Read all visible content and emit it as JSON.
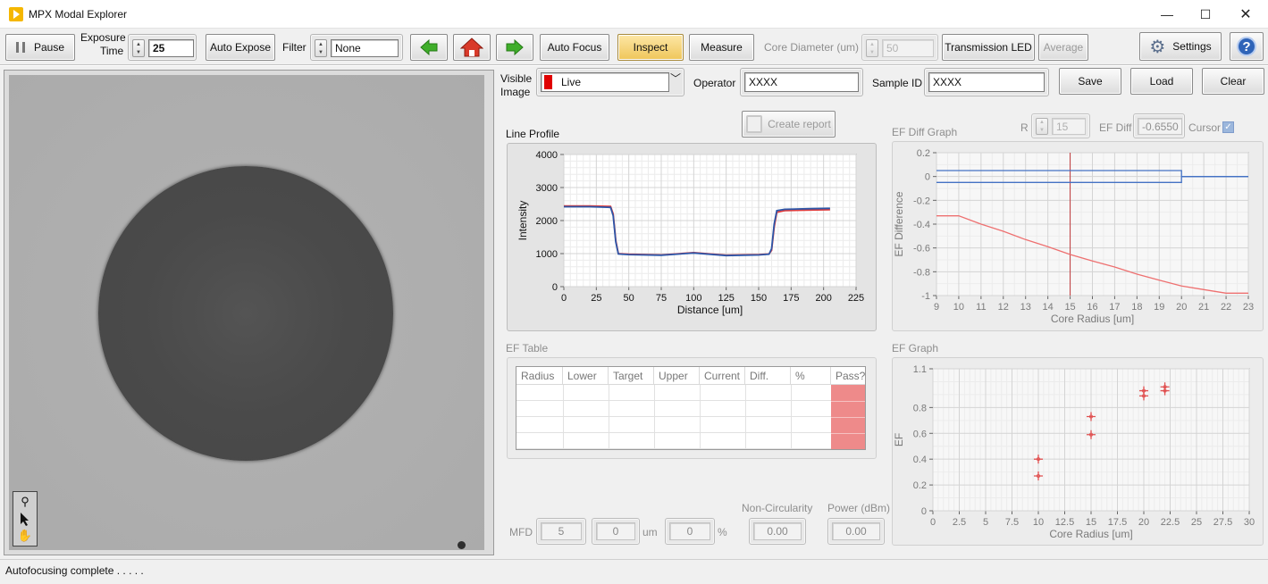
{
  "window": {
    "title": "MPX Modal Explorer"
  },
  "toolbar": {
    "pause": "Pause",
    "exposure_label_1": "Exposure",
    "exposure_label_2": "Time",
    "exposure_value": "25",
    "auto_expose": "Auto Expose",
    "filter_label": "Filter",
    "filter_value": "None",
    "auto_focus": "Auto Focus",
    "inspect": "Inspect",
    "measure": "Measure",
    "core_diameter_label": "Core Diameter (um)",
    "core_diameter_value": "50",
    "transmission_led": "Transmission LED",
    "average": "Average",
    "settings": "Settings"
  },
  "controls": {
    "visible_image_1": "Visible",
    "visible_image_2": "Image",
    "visible_image_value": "Live",
    "visible_image_color": "#e00000",
    "operator_label": "Operator",
    "operator_value": "XXXX",
    "sample_id_label": "Sample ID",
    "sample_id_value": "XXXX",
    "save": "Save",
    "load": "Load",
    "clear": "Clear",
    "create_report": "Create report"
  },
  "line_profile": {
    "title": "Line Profile",
    "xlabel": "Distance [um]",
    "ylabel": "Intensity",
    "x_ticks": [
      "0",
      "25",
      "50",
      "75",
      "100",
      "125",
      "150",
      "175",
      "200",
      "225"
    ],
    "y_ticks": [
      "0",
      "1000",
      "2000",
      "3000",
      "4000"
    ]
  },
  "ef_diff": {
    "title": "EF Diff Graph",
    "r_label": "R",
    "r_value": "15",
    "ef_diff_label": "EF Diff",
    "ef_diff_value": "-0.6550",
    "cursor_label": "Cursor",
    "xlabel": "Core Radius [um]",
    "ylabel": "EF Difference",
    "x_ticks": [
      "9",
      "10",
      "11",
      "12",
      "13",
      "14",
      "15",
      "16",
      "17",
      "18",
      "19",
      "20",
      "21",
      "22",
      "23"
    ],
    "y_ticks": [
      "0.2",
      "0",
      "-0.2",
      "-0.4",
      "-0.6",
      "-0.8",
      "-1"
    ]
  },
  "ef_table": {
    "title": "EF Table",
    "columns": [
      "Radius",
      "Lower",
      "Target",
      "Upper",
      "Current",
      "Diff.",
      "%",
      "Pass?"
    ],
    "fail_color": "#ee8a8a"
  },
  "ef_graph": {
    "title": "EF Graph",
    "xlabel": "Core Radius [um]",
    "ylabel": "EF",
    "x_ticks": [
      "0",
      "2.5",
      "5",
      "7.5",
      "10",
      "12.5",
      "15",
      "17.5",
      "20",
      "22.5",
      "25",
      "27.5",
      "30"
    ],
    "y_ticks": [
      "1.1",
      "0.8",
      "0.6",
      "0.4",
      "0.2",
      "0"
    ]
  },
  "measurements": {
    "mfd_label": "MFD",
    "mfd_value": "5",
    "mfd_value2": "0",
    "um_label": "um",
    "pct_value": "0",
    "pct_label": "%",
    "non_circ_label": "Non-Circularity",
    "non_circ_value": "0.00",
    "power_label": "Power (dBm)",
    "power_value": "0.00"
  },
  "status": {
    "text": "Autofocusing complete . . . . ."
  },
  "chart_data": [
    {
      "type": "line",
      "title": "Line Profile",
      "xlabel": "Distance [um]",
      "ylabel": "Intensity",
      "xlim": [
        0,
        225
      ],
      "ylim": [
        0,
        4000
      ],
      "grid": true,
      "series": [
        {
          "color": "#e03c3c",
          "x": [
            0,
            20,
            36,
            38,
            40,
            42,
            50,
            75,
            100,
            125,
            150,
            158,
            160,
            162,
            164,
            170,
            190,
            205
          ],
          "y": [
            2440,
            2440,
            2430,
            2200,
            1400,
            1000,
            980,
            960,
            1030,
            950,
            970,
            990,
            1100,
            1800,
            2250,
            2300,
            2320,
            2330
          ]
        },
        {
          "color": "#2c56a8",
          "x": [
            0,
            20,
            36,
            38,
            40,
            42,
            50,
            75,
            100,
            125,
            150,
            158,
            160,
            162,
            164,
            170,
            190,
            205
          ],
          "y": [
            2420,
            2420,
            2400,
            2150,
            1350,
            990,
            970,
            950,
            1020,
            940,
            960,
            980,
            1150,
            1900,
            2300,
            2340,
            2360,
            2370
          ]
        }
      ]
    },
    {
      "type": "line",
      "title": "EF Diff Graph",
      "xlabel": "Core Radius [um]",
      "ylabel": "EF Difference",
      "xlim": [
        9,
        23
      ],
      "ylim": [
        -1,
        0.2
      ],
      "grid": true,
      "cursor_x": 15,
      "series": [
        {
          "color": "#4472c4",
          "x": [
            9,
            20,
            20,
            22,
            22,
            23
          ],
          "y": [
            0.05,
            0.05,
            0.0,
            0.0,
            0.0,
            0.0
          ]
        },
        {
          "color": "#4472c4",
          "x": [
            9,
            20,
            20,
            22,
            22,
            23
          ],
          "y": [
            -0.05,
            -0.05,
            0.0,
            0.0,
            0.0,
            0.0
          ]
        },
        {
          "color": "#ee7070",
          "x": [
            9,
            10,
            11,
            12,
            13,
            14,
            15,
            16,
            17,
            18,
            19,
            20,
            21,
            22,
            23
          ],
          "y": [
            -0.33,
            -0.33,
            -0.4,
            -0.46,
            -0.53,
            -0.59,
            -0.655,
            -0.71,
            -0.76,
            -0.82,
            -0.87,
            -0.92,
            -0.95,
            -0.98,
            -0.98
          ]
        }
      ]
    },
    {
      "type": "scatter",
      "title": "EF Graph",
      "xlabel": "Core Radius [um]",
      "ylabel": "EF",
      "xlim": [
        0,
        30
      ],
      "ylim": [
        0,
        1.1
      ],
      "grid": true,
      "series": [
        {
          "color": "#e05050",
          "x": [
            10,
            10,
            15,
            15,
            20,
            20,
            22,
            22
          ],
          "y": [
            0.27,
            0.4,
            0.59,
            0.73,
            0.89,
            0.93,
            0.93,
            0.96
          ]
        }
      ]
    }
  ]
}
